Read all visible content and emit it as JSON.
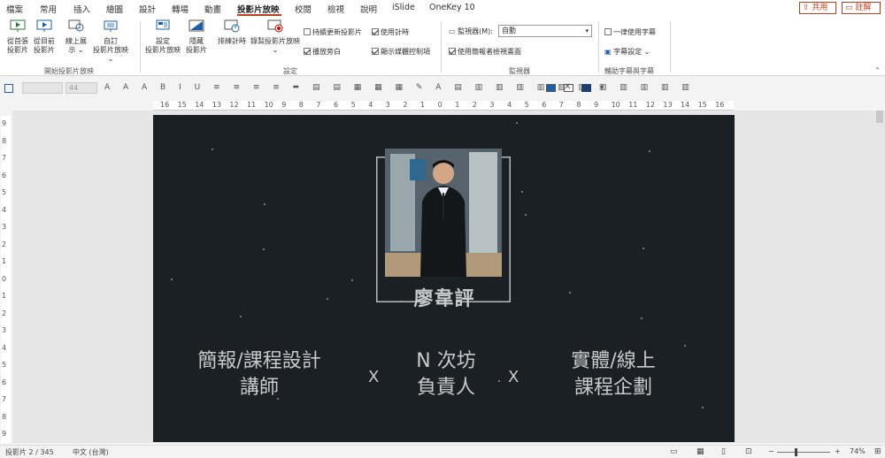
{
  "tabs": [
    "檔案",
    "常用",
    "插入",
    "繪圖",
    "設計",
    "轉場",
    "動畫",
    "投影片放映",
    "校閱",
    "檢視",
    "說明",
    "iSlide",
    "OneKey 10"
  ],
  "active_tab": "投影片放映",
  "share_label": "共用",
  "comment_label": "註解",
  "ribbon": {
    "start_group": {
      "label": "開始投影片放映",
      "buttons": [
        "從首張\n投影片",
        "從目前\n投影片",
        "線上展\n示 ⌄",
        "自訂\n投影片放映 ⌄"
      ]
    },
    "setup_group": {
      "label": "設定",
      "buttons": [
        "設定\n投影片放映",
        "隱藏\n投影片",
        "排練計時",
        "錄製投影片放映\n⌄"
      ],
      "checks": [
        {
          "label": "持續更新投影片",
          "checked": false
        },
        {
          "label": "播放旁白",
          "checked": true
        },
        {
          "label": "使用計時",
          "checked": true
        },
        {
          "label": "顯示媒體控制項",
          "checked": true
        }
      ]
    },
    "monitor_group": {
      "label": "監視器",
      "monitor_label": "監視器(M):",
      "monitor_value": "自動",
      "presenter_view": "使用簡報者檢視畫面",
      "presenter_checked": true
    },
    "captions_group": {
      "label": "輔助字幕與字幕",
      "always_captions": "一律使用字幕",
      "caption_settings": "字幕設定 ⌄"
    }
  },
  "format_bar": {
    "font_size": "44"
  },
  "ruler_h": [
    "16",
    "15",
    "14",
    "13",
    "12",
    "11",
    "10",
    "9",
    "8",
    "7",
    "6",
    "5",
    "4",
    "3",
    "2",
    "1",
    "0",
    "1",
    "2",
    "3",
    "4",
    "5",
    "6",
    "7",
    "8",
    "9",
    "10",
    "11",
    "12",
    "13",
    "14",
    "15",
    "16"
  ],
  "ruler_v": [
    "9",
    "8",
    "7",
    "6",
    "5",
    "4",
    "3",
    "2",
    "1",
    "0",
    "1",
    "2",
    "3",
    "4",
    "5",
    "6",
    "7",
    "8",
    "9"
  ],
  "slide": {
    "name": "廖韋評",
    "roles": [
      {
        "line1": "簡報/課程設計",
        "line2": "講師"
      },
      {
        "line1": "N 次坊",
        "line2": "負責人"
      },
      {
        "line1": "實體/線上",
        "line2": "課程企劃"
      }
    ],
    "separator": "X"
  },
  "status": {
    "slide_info": "投影片 2 / 345",
    "language": "中文 (台灣)",
    "zoom": "74%"
  }
}
